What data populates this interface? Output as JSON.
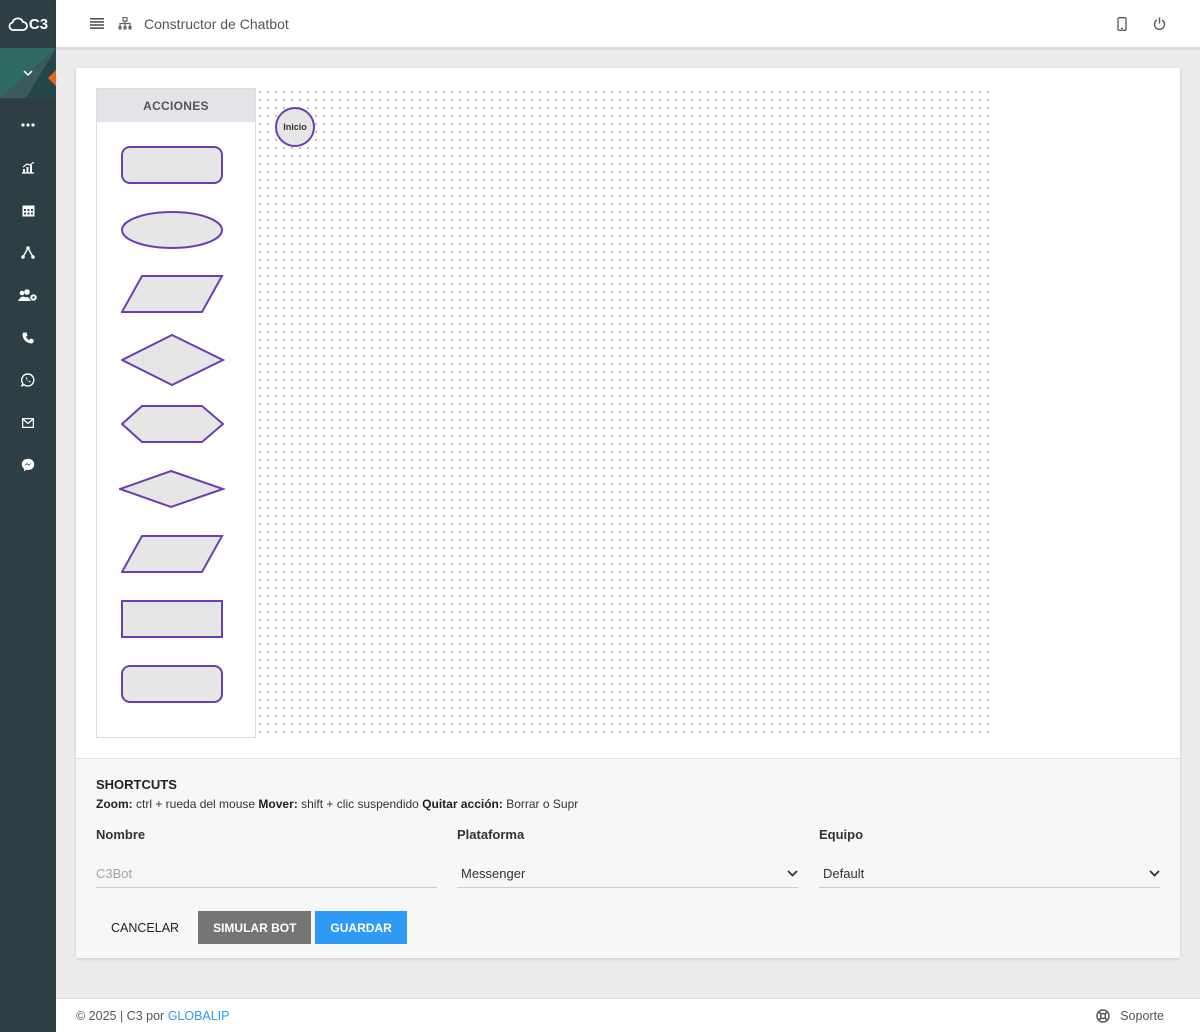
{
  "brand": {
    "logo_text": "C3"
  },
  "sidebar": {
    "items": [
      {
        "icon": "more-icon"
      },
      {
        "icon": "chart-icon"
      },
      {
        "icon": "calendar-icon"
      },
      {
        "icon": "network-icon"
      },
      {
        "icon": "users-gear-icon"
      },
      {
        "icon": "phone-icon"
      },
      {
        "icon": "whatsapp-icon"
      },
      {
        "icon": "mail-icon"
      },
      {
        "icon": "messenger-icon"
      }
    ]
  },
  "header": {
    "title": "Constructor de Chatbot"
  },
  "palette": {
    "title": "ACCIONES"
  },
  "canvas": {
    "start_node": "Inicio"
  },
  "shortcuts": {
    "title": "SHORTCUTS",
    "zoom_label": "Zoom:",
    "zoom_text": "ctrl + rueda del mouse",
    "move_label": "Mover:",
    "move_text": "shift + clic suspendido",
    "remove_label": "Quitar acción:",
    "remove_text": "Borrar o Supr"
  },
  "form": {
    "name_label": "Nombre",
    "name_placeholder": "C3Bot",
    "name_value": "",
    "platform_label": "Plataforma",
    "platform_value": "Messenger",
    "team_label": "Equipo",
    "team_value": "Default"
  },
  "actions": {
    "cancel": "CANCELAR",
    "simulate": "SIMULAR BOT",
    "save": "GUARDAR"
  },
  "footer": {
    "copyright": "© 2025 | C3 por",
    "company": "GLOBALIP",
    "support": "Soporte"
  },
  "colors": {
    "accent": "#2f9bf4",
    "shape_stroke": "#6a3fb4",
    "sidebar": "#2d3e44"
  }
}
